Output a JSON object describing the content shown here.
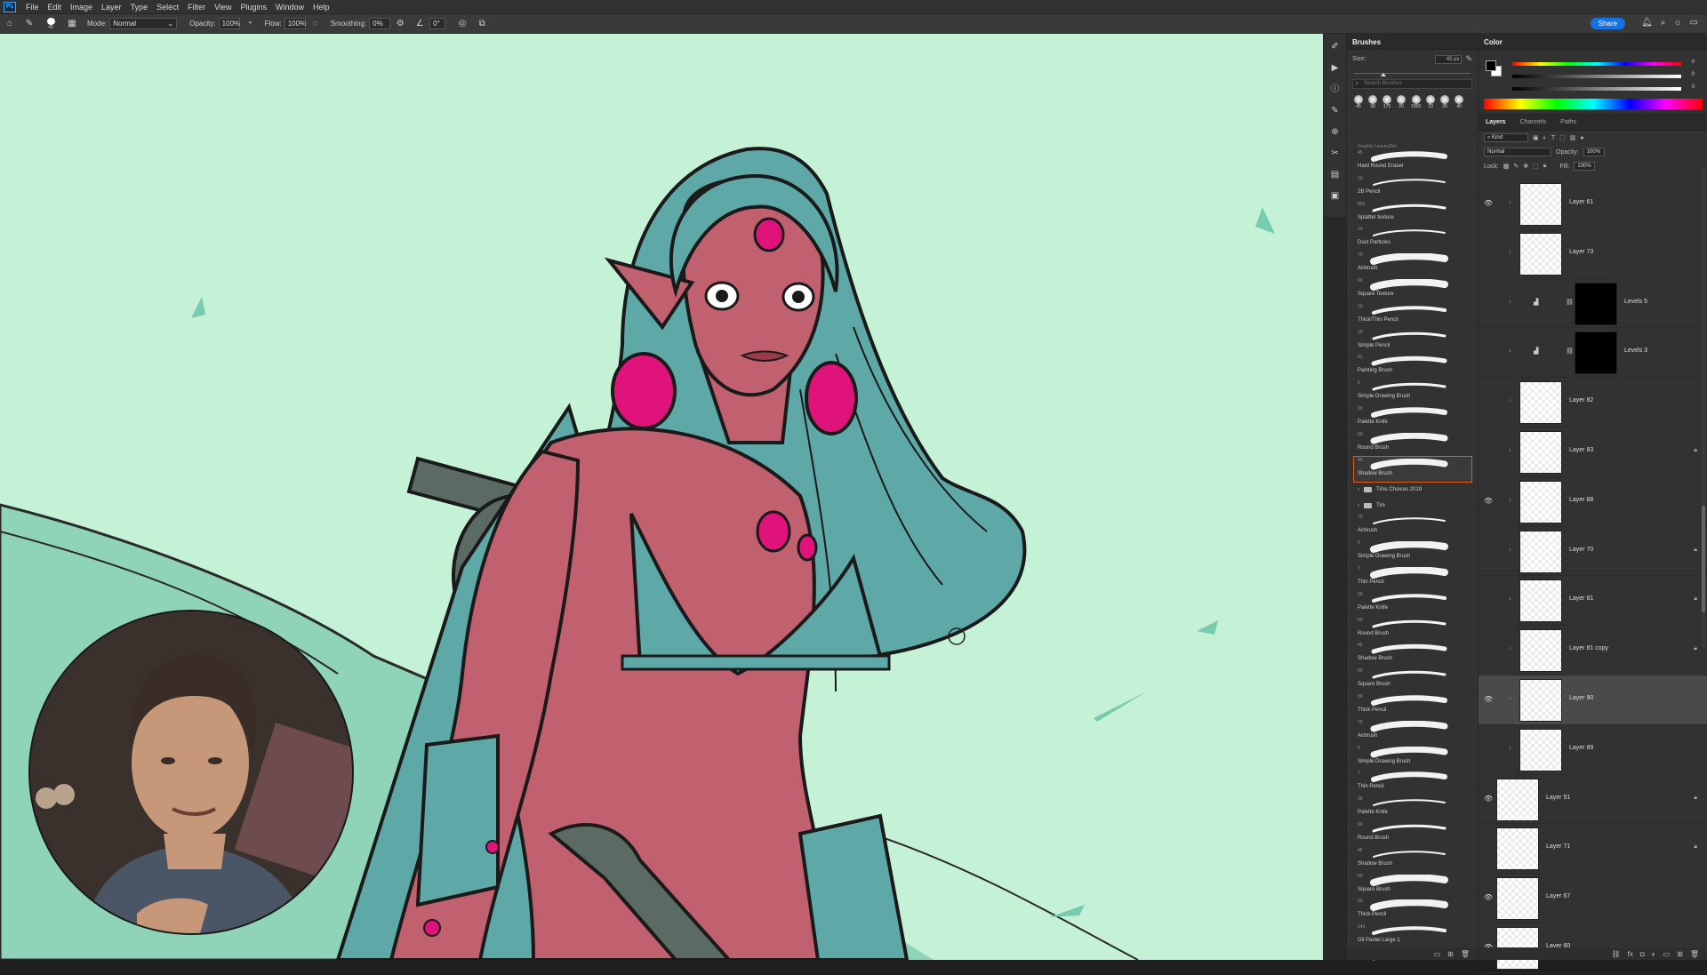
{
  "menubar": {
    "app_icon": "Ps",
    "items": [
      "File",
      "Edit",
      "Image",
      "Layer",
      "Type",
      "Select",
      "Filter",
      "View",
      "Plugins",
      "Window",
      "Help"
    ]
  },
  "options": {
    "brush_size": "45",
    "mode_label": "Mode:",
    "mode_value": "Normal",
    "opacity_label": "Opacity:",
    "opacity_value": "100%",
    "flow_label": "Flow:",
    "flow_value": "100%",
    "smoothing_label": "Smoothing:",
    "smoothing_value": "0%",
    "angle_value": "0°",
    "share_label": "Share"
  },
  "brushes_panel": {
    "title": "Brushes",
    "size_label": "Size:",
    "size_value": "45 px",
    "search_placeholder": "Search Brushes",
    "preset_sizes": [
      "45",
      "30",
      "175",
      "20",
      "1300",
      "23",
      "25",
      "40"
    ],
    "cut_off_label": "Graphic Leaves/Dirt",
    "items_top": [
      {
        "num": "45",
        "name": "Hard Round Eraser"
      },
      {
        "num": "10",
        "name": "2B Pencil"
      },
      {
        "num": "800",
        "name": "Splatter texture"
      },
      {
        "num": "14",
        "name": "Dust Particles"
      },
      {
        "num": "70",
        "name": "Airbrush"
      },
      {
        "num": "60",
        "name": "Square Texture"
      },
      {
        "num": "10",
        "name": "Thick/Thin Pencil"
      },
      {
        "num": "10",
        "name": "Simple Pencil"
      },
      {
        "num": "91",
        "name": "Painting Brush"
      },
      {
        "num": "5",
        "name": "Simple Drawing Brush"
      },
      {
        "num": "30",
        "name": "Palette Knife"
      },
      {
        "num": "60",
        "name": "Round Brush"
      },
      {
        "num": "45",
        "name": "Shadow Brush"
      }
    ],
    "selected_index": 12,
    "groups": [
      "Tims Choices 2019",
      "Tim"
    ],
    "items_bottom": [
      {
        "num": "70",
        "name": "Airbrush"
      },
      {
        "num": "5",
        "name": "Simple Drawing Brush"
      },
      {
        "num": "7",
        "name": "Thin Pencil"
      },
      {
        "num": "30",
        "name": "Palette Knife"
      },
      {
        "num": "60",
        "name": "Round Brush"
      },
      {
        "num": "45",
        "name": "Shadow Brush"
      },
      {
        "num": "60",
        "name": "Square Brush"
      },
      {
        "num": "30",
        "name": "Thick Pencil"
      },
      {
        "num": "70",
        "name": "Airbrush"
      },
      {
        "num": "5",
        "name": "Simple Drawing Brush"
      },
      {
        "num": "7",
        "name": "Thin Pencil"
      },
      {
        "num": "30",
        "name": "Palette Knife"
      },
      {
        "num": "60",
        "name": "Round Brush"
      },
      {
        "num": "45",
        "name": "Shadow Brush"
      },
      {
        "num": "60",
        "name": "Square Brush"
      },
      {
        "num": "30",
        "name": "Thick Pencil"
      },
      {
        "num": "143",
        "name": "Oil Pastel Large 1"
      },
      {
        "num": "379",
        "name": ""
      }
    ]
  },
  "color_panel": {
    "title": "Color",
    "foreground": "#000000",
    "background": "#ffffff",
    "values": [
      "0",
      "0",
      "0"
    ]
  },
  "layers_panel": {
    "tabs": [
      "Layers",
      "Channels",
      "Paths"
    ],
    "filter_label": "Kind",
    "blend_mode": "Normal",
    "opacity_label": "Opacity:",
    "opacity_value": "100%",
    "lock_label": "Lock:",
    "fill_label": "Fill:",
    "fill_value": "100%",
    "layers": [
      {
        "name": "Layer 61",
        "visible": true,
        "clipped": true,
        "locked": false,
        "kind": "pixel"
      },
      {
        "name": "Layer 73",
        "visible": false,
        "clipped": true,
        "locked": false,
        "kind": "pixel"
      },
      {
        "name": "Levels 5",
        "visible": false,
        "clipped": true,
        "locked": false,
        "kind": "adjustment"
      },
      {
        "name": "Levels 3",
        "visible": false,
        "clipped": true,
        "locked": false,
        "kind": "adjustment"
      },
      {
        "name": "Layer 82",
        "visible": false,
        "clipped": true,
        "locked": false,
        "kind": "pixel"
      },
      {
        "name": "Layer 83",
        "visible": false,
        "clipped": true,
        "locked": true,
        "kind": "pixel"
      },
      {
        "name": "Layer 88",
        "visible": true,
        "clipped": true,
        "locked": false,
        "kind": "pixel"
      },
      {
        "name": "Layer 70",
        "visible": false,
        "clipped": true,
        "locked": true,
        "kind": "pixel"
      },
      {
        "name": "Layer 81",
        "visible": false,
        "clipped": true,
        "locked": true,
        "kind": "pixel"
      },
      {
        "name": "Layer 81 copy",
        "visible": false,
        "clipped": true,
        "locked": true,
        "kind": "pixel"
      },
      {
        "name": "Layer 90",
        "visible": true,
        "clipped": true,
        "locked": false,
        "kind": "pixel",
        "selected": true
      },
      {
        "name": "Layer 89",
        "visible": false,
        "clipped": true,
        "locked": false,
        "kind": "pixel"
      },
      {
        "name": "Layer 51",
        "visible": true,
        "clipped": false,
        "locked": true,
        "kind": "pixel"
      },
      {
        "name": "Layer 71",
        "visible": false,
        "clipped": false,
        "locked": true,
        "kind": "pixel"
      },
      {
        "name": "Layer 67",
        "visible": true,
        "clipped": false,
        "locked": false,
        "kind": "pixel"
      },
      {
        "name": "Layer 60",
        "visible": true,
        "clipped": false,
        "locked": false,
        "kind": "pixel"
      }
    ]
  },
  "colors": {
    "canvas_bg": "#c5f2d7",
    "hair": "#5fa8a8",
    "skin": "#c1606e",
    "magenta": "#e0137a",
    "accent_selection": "#e05a1c",
    "share_blue": "#1473e6"
  }
}
